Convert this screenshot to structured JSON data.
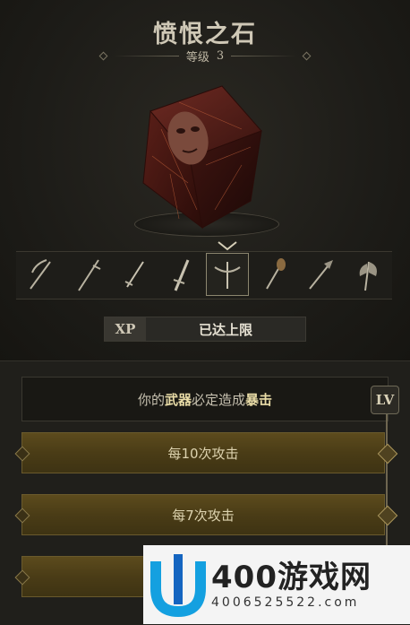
{
  "header": {
    "title": "愤恨之石",
    "level_label": "等级",
    "level_value": "3"
  },
  "item": {
    "name": "cursed-face-cube",
    "icon": "cube-with-face-icon"
  },
  "weapons": [
    {
      "icon": "scythe-icon",
      "selected": false
    },
    {
      "icon": "polearm-icon",
      "selected": false
    },
    {
      "icon": "sword-icon",
      "selected": false
    },
    {
      "icon": "greatsword-icon",
      "selected": false
    },
    {
      "icon": "crossbow-icon",
      "selected": true
    },
    {
      "icon": "mace-icon",
      "selected": false
    },
    {
      "icon": "halberd-icon",
      "selected": false
    },
    {
      "icon": "axe-icon",
      "selected": false
    }
  ],
  "xp": {
    "tag": "XP",
    "status": "已达上限"
  },
  "upgrades": {
    "crit_prefix": "你的",
    "crit_weapon": "武器",
    "crit_middle": "必定造成",
    "crit_effect": "暴击",
    "lv_badge": "LV",
    "options": [
      {
        "label": "每10次攻击"
      },
      {
        "label": "每7次攻击"
      },
      {
        "label": ""
      }
    ]
  },
  "watermark": {
    "brand": "400游戏网",
    "url": "4006525522.com"
  },
  "colors": {
    "accent_gold": "#5c4b1d",
    "highlight": "#e9dca7",
    "bg": "#1a1915"
  }
}
